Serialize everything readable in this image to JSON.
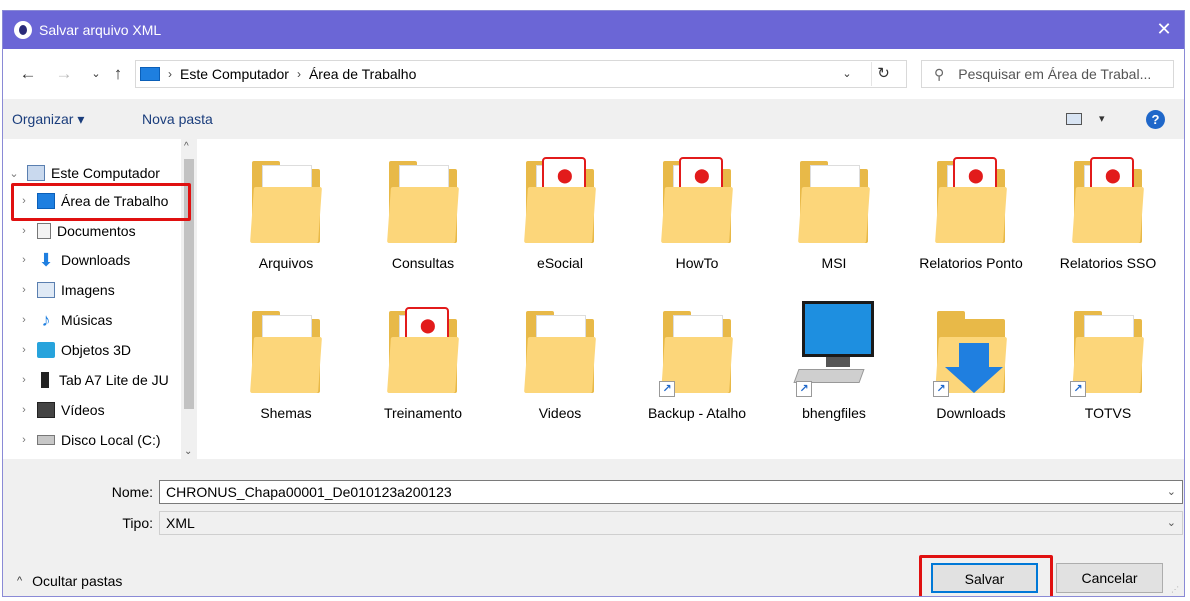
{
  "window": {
    "title": "Salvar arquivo XML",
    "close": "✕"
  },
  "address": {
    "breadcrumbs": [
      "Este Computador",
      "Área de Trabalho"
    ],
    "search_placeholder": "Pesquisar em Área de Trabal..."
  },
  "toolbar": {
    "organize": "Organizar ▾",
    "new_folder": "Nova pasta",
    "help": "?"
  },
  "nav": {
    "items": [
      {
        "label": "Este Computador",
        "icon": "computer-icon",
        "expanded": true
      },
      {
        "label": "Área de Trabalho",
        "icon": "desktop-icon",
        "selected": true
      },
      {
        "label": "Documentos",
        "icon": "documents-icon"
      },
      {
        "label": "Downloads",
        "icon": "download-icon"
      },
      {
        "label": "Imagens",
        "icon": "images-icon"
      },
      {
        "label": "Músicas",
        "icon": "music-icon"
      },
      {
        "label": "Objetos 3D",
        "icon": "cube-icon"
      },
      {
        "label": "Tab A7 Lite de JU",
        "icon": "phone-icon"
      },
      {
        "label": "Vídeos",
        "icon": "video-icon"
      },
      {
        "label": "Disco Local (C:)",
        "icon": "drive-icon"
      }
    ]
  },
  "files": [
    {
      "label": "Arquivos",
      "type": "folder-doc"
    },
    {
      "label": "Consultas",
      "type": "folder-pencil"
    },
    {
      "label": "eSocial",
      "type": "folder-pdf"
    },
    {
      "label": "HowTo",
      "type": "folder-pdf"
    },
    {
      "label": "MSI",
      "type": "folder-plain"
    },
    {
      "label": "Relatorios Ponto",
      "type": "folder-pdf"
    },
    {
      "label": "Relatorios SSO",
      "type": "folder-pdf"
    },
    {
      "label": "Shemas",
      "type": "folder-plain"
    },
    {
      "label": "Treinamento",
      "type": "folder-word"
    },
    {
      "label": "Videos",
      "type": "folder-plain"
    },
    {
      "label": "Backup - Atalho",
      "type": "folder-shortcut"
    },
    {
      "label": "bhengfiles",
      "type": "computer-shortcut"
    },
    {
      "label": "Downloads",
      "type": "downloads-shortcut"
    },
    {
      "label": "TOTVS",
      "type": "folder-shortcut"
    }
  ],
  "form": {
    "name_label": "Nome:",
    "name_value": "CHRONUS_Chapa00001_De010123a200123",
    "type_label": "Tipo:",
    "type_value": "XML"
  },
  "footer": {
    "hide_folders": "Ocultar pastas",
    "save": "Salvar",
    "cancel": "Cancelar"
  },
  "colors": {
    "titlebar": "#6b66d6",
    "highlight": "#e01010",
    "accent": "#0078d7"
  }
}
